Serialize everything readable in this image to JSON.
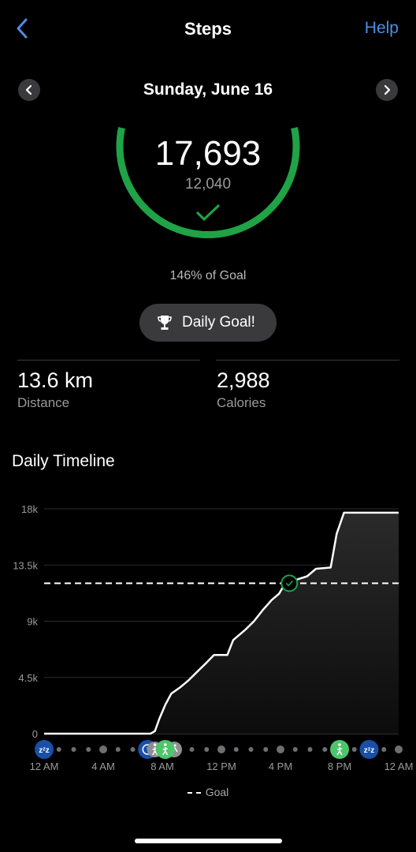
{
  "header": {
    "title": "Steps",
    "help_label": "Help",
    "back_icon": "chevron-left-icon"
  },
  "date_nav": {
    "label": "Sunday, June 16",
    "prev_icon": "chevron-left-icon",
    "next_icon": "chevron-right-icon"
  },
  "summary": {
    "steps": "17,693",
    "goal": "12,040",
    "percent_label": "146% of Goal",
    "goal_fraction": 1.0,
    "badge_label": "Daily Goal!",
    "badge_icon": "trophy-icon",
    "ring_color": "#1fa346"
  },
  "stats": [
    {
      "value": "13.6 km",
      "label": "Distance"
    },
    {
      "value": "2,988",
      "label": "Calories"
    }
  ],
  "timeline": {
    "title": "Daily Timeline",
    "legend_label": "Goal"
  },
  "chart_data": {
    "type": "area",
    "yticks": [
      "0",
      "4.5k",
      "9k",
      "13.5k",
      "18k"
    ],
    "ylim": [
      0,
      18000
    ],
    "xlim": [
      0,
      24
    ],
    "xticks": [
      "12 AM",
      "4 AM",
      "8 AM",
      "12 PM",
      "4 PM",
      "8 PM",
      "12 AM"
    ],
    "goal": 12040,
    "goal_reached_hour": 16.6,
    "series": [
      {
        "values": [
          [
            0,
            0
          ],
          [
            7.2,
            0
          ],
          [
            7.5,
            200
          ],
          [
            7.8,
            1200
          ],
          [
            8.2,
            2300
          ],
          [
            8.6,
            3200
          ],
          [
            9.2,
            3700
          ],
          [
            9.8,
            4300
          ],
          [
            10.4,
            5000
          ],
          [
            11,
            5700
          ],
          [
            11.5,
            6300
          ],
          [
            12.4,
            6300
          ],
          [
            12.8,
            7500
          ],
          [
            13.6,
            8300
          ],
          [
            14.2,
            9000
          ],
          [
            14.8,
            9900
          ],
          [
            15.4,
            10700
          ],
          [
            15.9,
            11200
          ],
          [
            16.3,
            12000
          ],
          [
            17,
            12300
          ],
          [
            17.8,
            12600
          ],
          [
            18.4,
            13200
          ],
          [
            19.4,
            13300
          ],
          [
            19.8,
            16000
          ],
          [
            20.3,
            17693
          ],
          [
            24,
            17693
          ]
        ]
      }
    ],
    "activity_markers": [
      {
        "hour": 0,
        "icon": "sleep-icon",
        "color": "#1a4fa8"
      },
      {
        "hour": 7,
        "icon": "clock-icon",
        "color": "#1a4fa8"
      },
      {
        "hour": 7.5,
        "icon": "walk-icon",
        "color": "#8e8e93"
      },
      {
        "hour": 8.8,
        "icon": "run-icon",
        "color": "#8e8e93"
      },
      {
        "hour": 8.2,
        "icon": "walk-icon",
        "color": "#4ec56a"
      },
      {
        "hour": 20,
        "icon": "walk-icon",
        "color": "#4ec56a"
      },
      {
        "hour": 22,
        "icon": "sleep-icon",
        "color": "#1a4fa8"
      }
    ]
  }
}
